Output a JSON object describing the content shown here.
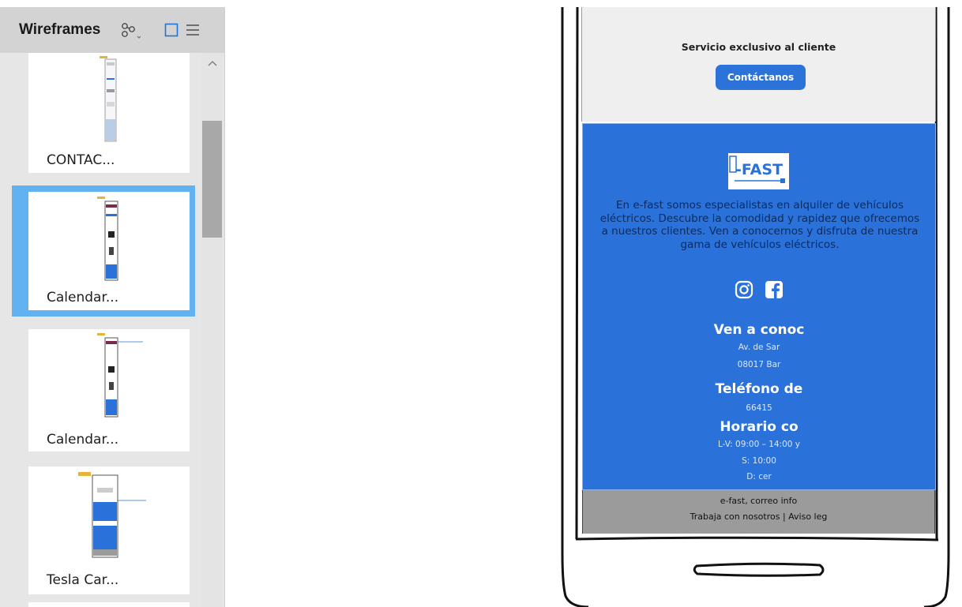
{
  "panel": {
    "title": "Wireframes",
    "icons": [
      "branches-icon",
      "square-view-icon",
      "list-view-icon"
    ],
    "items": [
      {
        "label": "CONTAC...",
        "selected": false
      },
      {
        "label": "Calendar...",
        "selected": true
      },
      {
        "label": "Calendar...",
        "selected": false
      },
      {
        "label": "Tesla Car...",
        "selected": false
      }
    ]
  },
  "phone": {
    "service_text": "Servicio exclusivo al cliente",
    "contact_button": "Contáctanos",
    "footer": {
      "logo_text": "-FAST",
      "about": "En e-fast somos especialistas en alquiler de vehículos eléctricos. Descubre la comodidad y rapidez que ofrecemos a nuestros clientes. Ven a conocernos y disfruta de nuestra gama de vehículos eléctricos.",
      "visit_heading": "Ven a conoc",
      "address_line1": "Av. de Sar",
      "address_line2": "08017 Bar",
      "phone_heading": "Teléfono de",
      "phone_number": "66415",
      "hours_heading": "Horario co",
      "hours_weekdays": "L-V: 09:00 – 14:00 y",
      "hours_saturday": "S: 10:00",
      "hours_sunday": "D: cer"
    },
    "bottom": {
      "line1": "e-fast, correo info",
      "line2": "Trabaja con nosotros | Aviso leg"
    }
  },
  "colors": {
    "accent_blue": "#2a72d9",
    "selection_blue": "#62b1f0",
    "panel_bg": "#e6e6e6",
    "panel_header_bg": "#d3d3d3"
  }
}
